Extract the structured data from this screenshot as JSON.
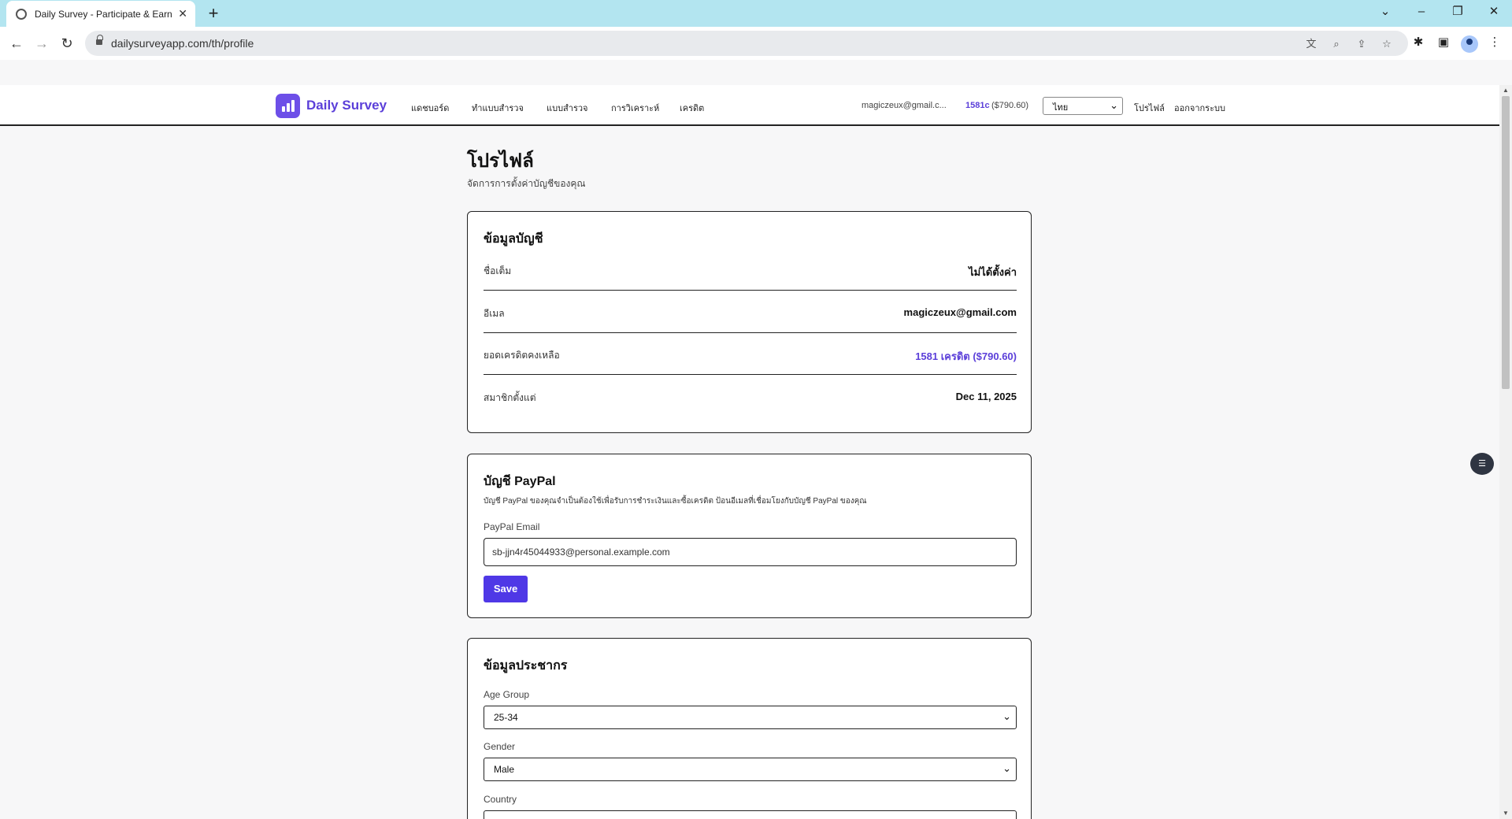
{
  "browser": {
    "tab_title": "Daily Survey - Participate & Earn",
    "url": "dailysurveyapp.com/th/profile"
  },
  "header": {
    "brand": "Daily Survey",
    "nav": [
      "แดชบอร์ด",
      "ทำแบบสำรวจ",
      "แบบสำรวจ",
      "การวิเคราะห์",
      "เครดิต"
    ],
    "email": "magiczeux@gmail.c...",
    "credits": "1581c",
    "credits_usd": "($790.60)",
    "language": "ไทย",
    "profile_link": "โปรไฟล์",
    "logout_link": "ออกจากระบบ"
  },
  "page": {
    "title": "โปรไฟล์",
    "subtitle": "จัดการการตั้งค่าบัญชีของคุณ"
  },
  "account_card": {
    "title": "ข้อมูลบัญชี",
    "rows": [
      {
        "label": "ชื่อเต็ม",
        "value": "ไม่ได้ตั้งค่า"
      },
      {
        "label": "อีเมล",
        "value": "magiczeux@gmail.com"
      },
      {
        "label": "ยอดเครดิตคงเหลือ",
        "value": "1581 เครดิต ($790.60)"
      },
      {
        "label": "สมาชิกตั้งแต่",
        "value": "Dec 11, 2025"
      }
    ]
  },
  "paypal_card": {
    "title": "บัญชี PayPal",
    "description": "บัญชี PayPal ของคุณจำเป็นต้องใช้เพื่อรับการชำระเงินและซื้อเครดิต ป้อนอีเมลที่เชื่อมโยงกับบัญชี PayPal ของคุณ",
    "email_label": "PayPal Email",
    "email_value": "sb-jjn4r45044933@personal.example.com",
    "save_label": "Save"
  },
  "demographics_card": {
    "title": "ข้อมูลประชากร",
    "age_label": "Age Group",
    "age_value": "25-34",
    "gender_label": "Gender",
    "gender_value": "Male",
    "country_label": "Country"
  },
  "colors": {
    "accent": "#5b3fd9",
    "button": "#4f38e6",
    "tabbar": "#b3e5f0"
  }
}
